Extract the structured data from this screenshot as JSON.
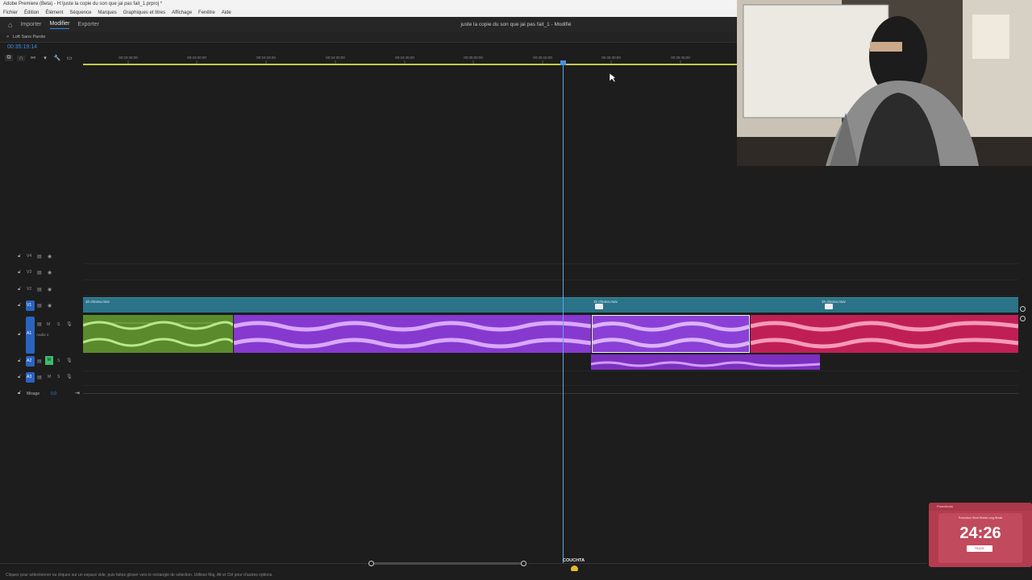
{
  "window": {
    "title": "Adobe Premiere (Beta) - H:\\juste la copie du son que jai pas fait_1.prproj *"
  },
  "menu": [
    "Fichier",
    "Édition",
    "Élément",
    "Séquence",
    "Marques",
    "Graphiques et titres",
    "Affichage",
    "Fenêtre",
    "Aide"
  ],
  "workspace": {
    "items": [
      "Importer",
      "Modifier",
      "Exporter"
    ],
    "active": "Modifier",
    "sequence_title": "juste la copie du son que jai pas fait_1 - Modifié"
  },
  "timeline": {
    "tab": "Loft Sans Parole",
    "timecode": "00:35:19:14",
    "ruler_labels": [
      "00:33:45:00",
      "00:34:00:00",
      "00:34:15:00",
      "00:34:30:00",
      "00:34:45:00",
      "00:35:00:00",
      "00:35:15:00",
      "00:35:30:00",
      "00:35:45:00"
    ],
    "video_tracks": [
      "V4",
      "V3",
      "V2",
      "V1"
    ],
    "audio_tracks": [
      "A1",
      "A2",
      "A3"
    ],
    "a1_name": "Audio 1",
    "mix_label": "Mixage",
    "mix_value": "0,0",
    "clip_name": "1h chrono.mov"
  },
  "status": {
    "text": "Cliquez pour sélectionner ou cliquez sur un espace vide, puis faites glisser vers le rectangle de sélection. Utilisez Maj, Alt et Ctrl pour d'autres options."
  },
  "overlay": {
    "timer": "24:26",
    "timer_brand": "Pomofocus",
    "timer_modes": "Pomodoro   Short Break   Long Break",
    "timer_button": "PAUSE",
    "couchta_label": "COUCHTA"
  },
  "colors": {
    "accent": "#2d8ceb",
    "green_clip": "#5a8a2c",
    "purple_clip": "#8639ce",
    "red_clip": "#c01f55",
    "video_clip": "#2a7388"
  }
}
